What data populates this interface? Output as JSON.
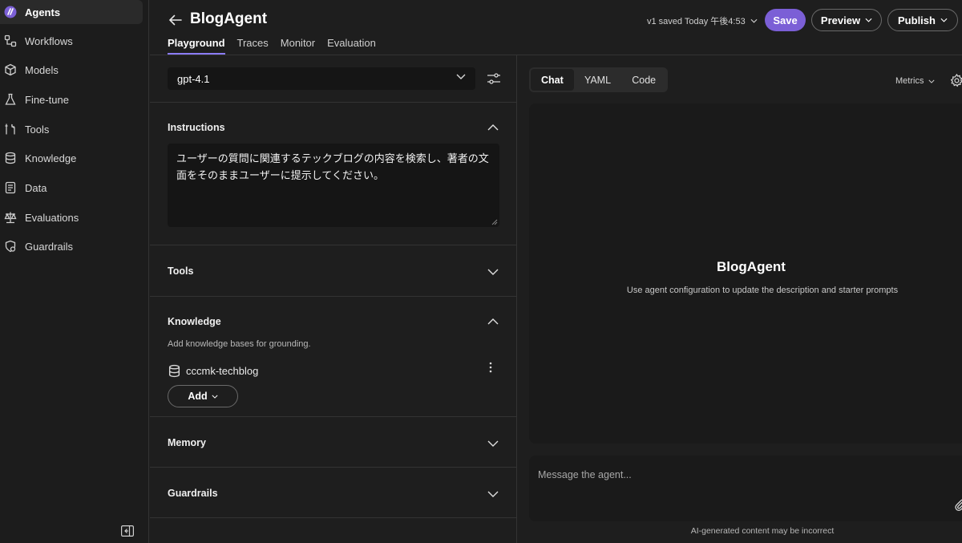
{
  "sidebar": {
    "items": [
      {
        "label": "Agents",
        "icon": "agents-logo-icon",
        "active": true
      },
      {
        "label": "Workflows",
        "icon": "workflows-icon"
      },
      {
        "label": "Models",
        "icon": "models-cube-icon"
      },
      {
        "label": "Fine-tune",
        "icon": "flask-icon"
      },
      {
        "label": "Tools",
        "icon": "tools-icon"
      },
      {
        "label": "Knowledge",
        "icon": "database-icon"
      },
      {
        "label": "Data",
        "icon": "document-icon"
      },
      {
        "label": "Evaluations",
        "icon": "scale-icon"
      },
      {
        "label": "Guardrails",
        "icon": "shield-icon"
      }
    ]
  },
  "header": {
    "title": "BlogAgent",
    "tabs": [
      "Playground",
      "Traces",
      "Monitor",
      "Evaluation"
    ],
    "saved_status": "v1 saved Today 午後4:53",
    "save_label": "Save",
    "preview_label": "Preview",
    "publish_label": "Publish"
  },
  "config": {
    "model": "gpt-4.1",
    "instructions_title": "Instructions",
    "instructions_text": "ユーザーの質問に関連するテックブログの内容を検索し、著者の文面をそのままユーザーに提示してください。",
    "tools_title": "Tools",
    "knowledge_title": "Knowledge",
    "knowledge_helper": "Add knowledge bases for grounding.",
    "knowledge_item": "cccmk-techblog",
    "add_label": "Add",
    "memory_title": "Memory",
    "guardrails_title": "Guardrails"
  },
  "chat": {
    "view_tabs": [
      "Chat",
      "YAML",
      "Code"
    ],
    "metrics_label": "Metrics",
    "agent_name": "BlogAgent",
    "agent_description": "Use agent configuration to update the description and starter prompts",
    "message_placeholder": "Message the agent...",
    "disclaimer": "AI-generated content may be incorrect"
  },
  "colors": {
    "accent": "#7b5fd6",
    "background": "#1e1e1e",
    "panel": "#1a1a1a"
  }
}
